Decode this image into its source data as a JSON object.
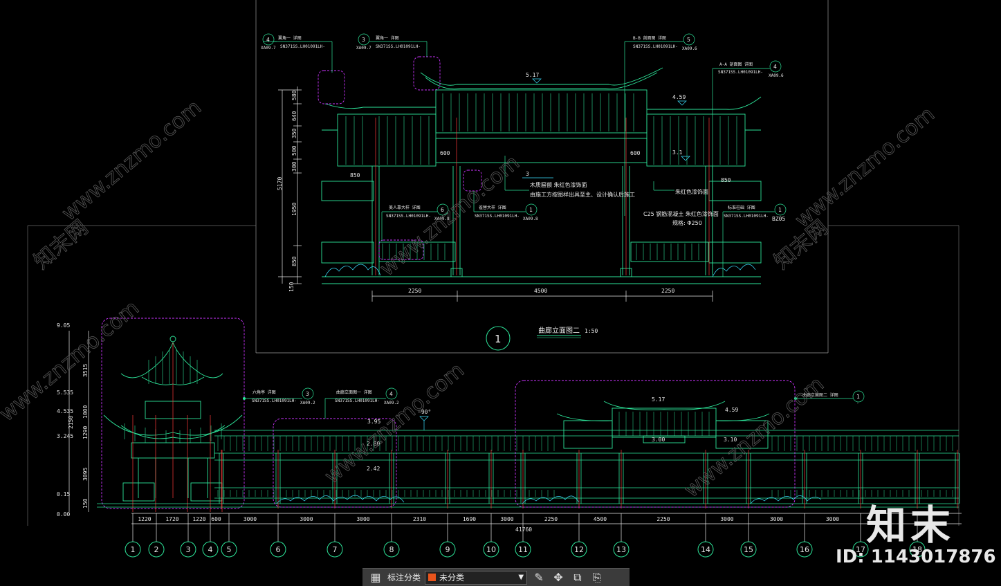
{
  "colors": {
    "background": "#000000",
    "green": "#2de59a",
    "cyan": "#3be0ff",
    "red": "#ff3b3b",
    "magenta": "#cc33ff",
    "yellow": "#e6d63a",
    "dim": "#8a8a8a"
  },
  "upper_elevation": {
    "overall_height": "5170",
    "left_dims": [
      "580",
      "640",
      "350",
      "500",
      "300",
      "1950",
      "850",
      "150"
    ],
    "bottom_dims": [
      "2250",
      "4500",
      "2250"
    ],
    "levels": [
      "5.17",
      "4.59",
      "3.1",
      "3"
    ],
    "span_labels": [
      "600",
      "600",
      "850",
      "850"
    ],
    "callouts": [
      {
        "num": "4",
        "ref": "XA09.7",
        "title": "翼角一 详图",
        "spec": "SN371SS.LH01091LH-"
      },
      {
        "num": "3",
        "ref": "XA09.7",
        "title": "翼角一 详图",
        "spec": "SN371SS.LH01091LH-"
      },
      {
        "num": "5",
        "ref": "XA09.6",
        "title": "B-B 剖面图 详图",
        "spec": "SN371SS.LH01091LH-"
      },
      {
        "num": "4",
        "ref": "XA09.6",
        "title": "A-A 剖面图 详图",
        "spec": "SN371SS.LH01091LH-"
      },
      {
        "num": "6",
        "ref": "XA09.8",
        "title": "美人靠大样 详图",
        "spec": "SN371SS.LH01091LH-"
      },
      {
        "num": "1",
        "ref": "XA09.8",
        "title": "雀替大样 详图",
        "spec": "SN371SS.LH01091LH-"
      },
      {
        "num": "1",
        "ref": "BZ05",
        "title": "标准柱础 详图",
        "spec": "SN371SS.LH01091LH-"
      }
    ],
    "notes": [
      "木质匾额 朱红色漆饰面",
      "由施工方按图样出具至主、设计确认后施工",
      "朱红色漆饰面",
      "C25 钢筋混凝土 朱红色漆饰面",
      "规格: Φ250"
    ],
    "title_number": "1",
    "title": "曲廊立面图二",
    "scale": "1:50"
  },
  "lower_elevation": {
    "left_levels": [
      "9.05",
      "5.535",
      "4.535",
      "3.245",
      "0.15",
      "0.00"
    ],
    "left_dims": [
      "3515",
      "1000",
      "1290",
      "3095",
      "150",
      "2150"
    ],
    "levels": [
      "3.95",
      "2.80",
      "2.42",
      "5.17",
      "4.59",
      "3.00",
      "3.10"
    ],
    "angle": "~90°",
    "dims": [
      "1220",
      "1720",
      "1220",
      "600",
      "3000",
      "3000",
      "3000",
      "2310",
      "1690",
      "3000",
      "2250",
      "4500",
      "2250",
      "3000",
      "3000",
      "3000"
    ],
    "total": "41760",
    "axes": [
      "1",
      "2",
      "3",
      "4",
      "5",
      "6",
      "7",
      "8",
      "9",
      "10",
      "11",
      "12",
      "13",
      "14",
      "15",
      "16",
      "17",
      "18"
    ],
    "callouts": [
      {
        "num": "3",
        "ref": "XA09.2",
        "title": "六角亭 详图",
        "spec": "SN371SS.LH01091LH-"
      },
      {
        "num": "4",
        "ref": "XA09.2",
        "title": "曲廊立面图一 详图",
        "spec": "SN371SS.LH01091LH-"
      },
      {
        "num": "1",
        "ref": "-",
        "title": "曲廊立面图二 详图",
        "spec": ""
      }
    ]
  },
  "watermarks": {
    "diagonal": "www.znzmo.com",
    "brand": "知末网",
    "big": "知末",
    "id": "ID: 1143017876"
  },
  "toolbar": {
    "grid_icon": "grid-icon",
    "label": "标注分类",
    "category_value": "未分类",
    "category_color": "#e8541c",
    "icons": [
      "edit-icon",
      "move-icon",
      "copy-icon",
      "paste-icon"
    ]
  }
}
